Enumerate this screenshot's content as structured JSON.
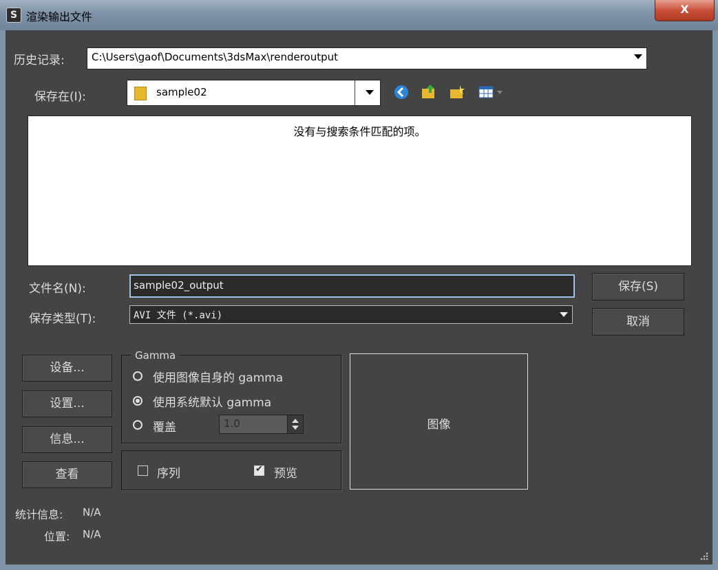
{
  "window": {
    "title": "渲染输出文件",
    "close_label": "X"
  },
  "history": {
    "label": "历史记录:",
    "value": "C:\\Users\\gaof\\Documents\\3dsMax\\renderoutput"
  },
  "save_in": {
    "label": "保存在(I):",
    "value": "sample02"
  },
  "toolbar": {
    "icons": [
      "back-icon",
      "up-folder-icon",
      "new-folder-icon",
      "view-menu-icon"
    ]
  },
  "file_list": {
    "empty_message": "没有与搜索条件匹配的项。"
  },
  "filename": {
    "label": "文件名(N):",
    "value": "sample02_output"
  },
  "save_type": {
    "label": "保存类型(T):",
    "value": "AVI 文件 (*.avi)"
  },
  "buttons": {
    "save": "保存(S)",
    "cancel": "取消",
    "device": "设备...",
    "setup": "设置...",
    "info": "信息...",
    "view": "查看"
  },
  "gamma": {
    "title": "Gamma",
    "options": [
      "使用图像自身的 gamma",
      "使用系统默认 gamma",
      "覆盖"
    ],
    "selected_index": 1,
    "override_value": "1.0"
  },
  "sequence": {
    "label": "序列",
    "checked": false
  },
  "preview": {
    "label": "预览",
    "checked": true
  },
  "image_panel": {
    "label": "图像"
  },
  "stats": {
    "label": "统计信息:",
    "value": "N/A"
  },
  "location": {
    "label": "位置:",
    "value": "N/A"
  },
  "colors": {
    "background": "#444444",
    "titlebar": "#7f93a8",
    "close": "#c9503a"
  }
}
